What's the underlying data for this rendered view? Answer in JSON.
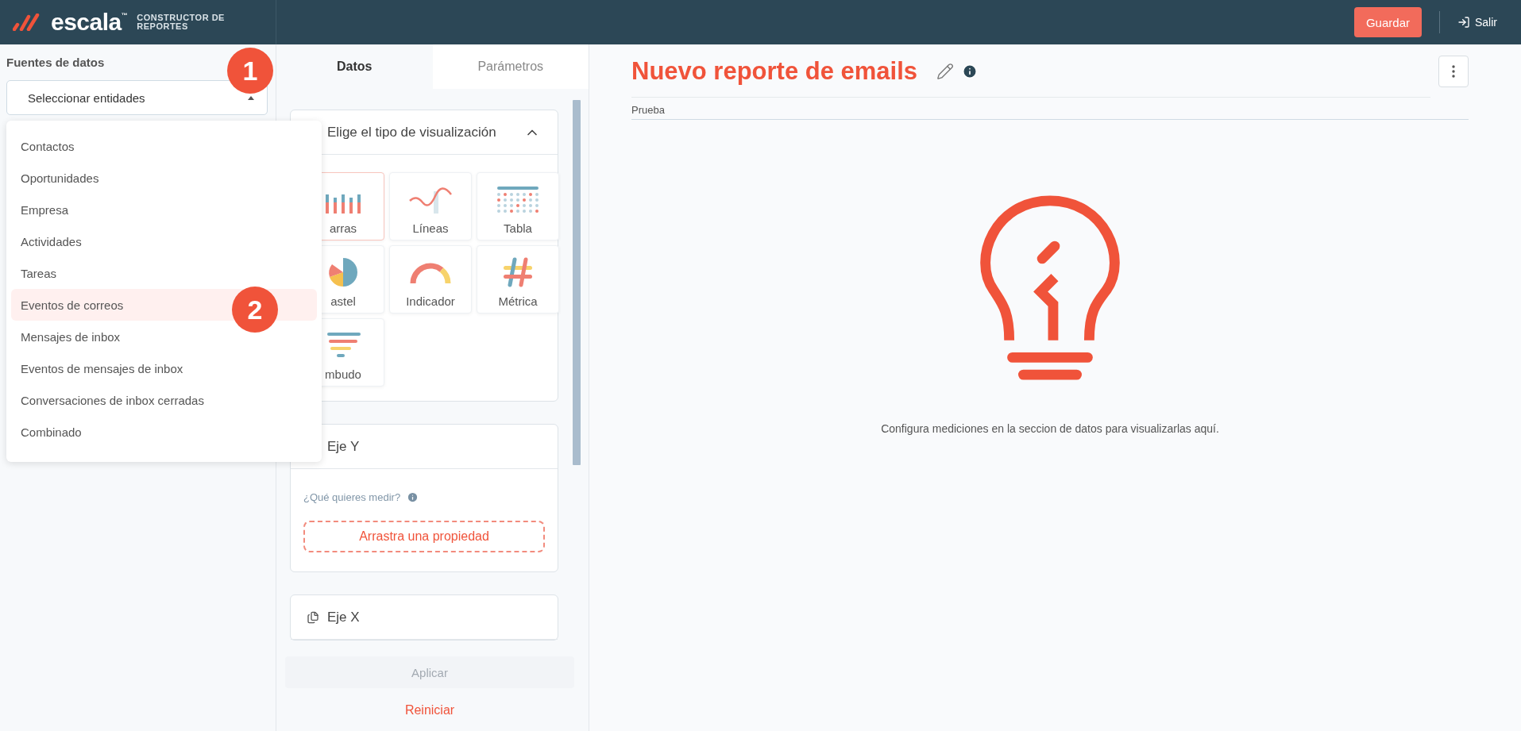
{
  "header": {
    "brand": "escala",
    "brand_mark": "™",
    "subtitle": "CONSTRUCTOR DE REPORTES",
    "save_button": "Guardar",
    "exit_button": "Salir"
  },
  "sidebar": {
    "title": "Fuentes de datos",
    "select": {
      "value": "Seleccionar entidades",
      "expanded": true
    },
    "options": [
      {
        "label": "Contactos",
        "selected": false
      },
      {
        "label": "Oportunidades",
        "selected": false
      },
      {
        "label": "Empresa",
        "selected": false
      },
      {
        "label": "Actividades",
        "selected": false
      },
      {
        "label": "Tareas",
        "selected": false
      },
      {
        "label": "Eventos de correos",
        "selected": true
      },
      {
        "label": "Mensajes de inbox",
        "selected": false
      },
      {
        "label": "Eventos de mensajes de inbox",
        "selected": false
      },
      {
        "label": "Conversaciones de inbox cerradas",
        "selected": false
      },
      {
        "label": "Combinado",
        "selected": false
      }
    ]
  },
  "callouts": [
    "1",
    "2"
  ],
  "config_panel": {
    "tabs": [
      {
        "label": "Datos",
        "selected": true
      },
      {
        "label": "Parámetros",
        "selected": false
      }
    ],
    "visualization": {
      "title": "Elige el tipo de visualización",
      "expanded": true,
      "types": [
        {
          "label": "arras",
          "kind": "bars",
          "selected": true
        },
        {
          "label": "Líneas",
          "kind": "lines",
          "selected": false
        },
        {
          "label": "Tabla",
          "kind": "table",
          "selected": false
        },
        {
          "label": "astel",
          "kind": "pie",
          "selected": false
        },
        {
          "label": "Indicador",
          "kind": "gauge",
          "selected": false
        },
        {
          "label": "Métrica",
          "kind": "metric",
          "selected": false
        },
        {
          "label": "mbudo",
          "kind": "funnel",
          "selected": false
        }
      ]
    },
    "y_axis": {
      "title": "Eje Y",
      "prompt": "¿Qué quieres medir?",
      "dropzone": "Arrastra una propiedad"
    },
    "x_axis": {
      "title": "Eje X"
    },
    "apply_button": {
      "label": "Aplicar",
      "disabled": true
    },
    "reset_button": "Reiniciar"
  },
  "report": {
    "title": "Nuevo reporte de emails",
    "description": "Prueba",
    "empty_message": "Configura mediciones en la seccion de datos para visualizarlas aquí."
  }
}
